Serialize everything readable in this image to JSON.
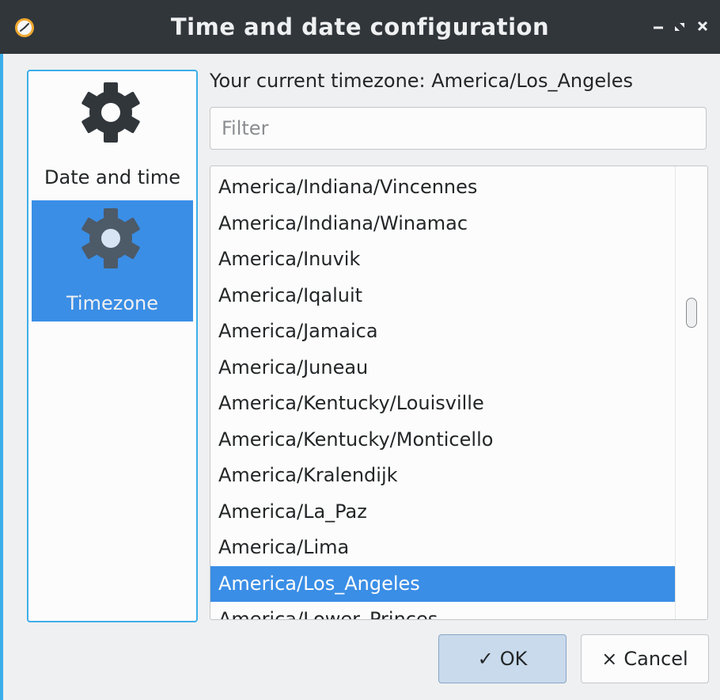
{
  "window": {
    "title": "Time and date configuration",
    "controls": [
      "minimize",
      "maximize",
      "close"
    ]
  },
  "sidebar": {
    "items": [
      {
        "label": "Date and time",
        "icon": "gear-icon",
        "selected": false
      },
      {
        "label": "Timezone",
        "icon": "gear-icon",
        "selected": true
      }
    ]
  },
  "timezone": {
    "current_label": "Your current timezone:  America/Los_Angeles"
  },
  "filter": {
    "placeholder": "Filter",
    "value": ""
  },
  "timezone_list": {
    "items": [
      "America/Indiana/Vincennes",
      "America/Indiana/Winamac",
      "America/Inuvik",
      "America/Iqaluit",
      "America/Jamaica",
      "America/Juneau",
      "America/Kentucky/Louisville",
      "America/Kentucky/Monticello",
      "America/Kralendijk",
      "America/La_Paz",
      "America/Lima",
      "America/Los_Angeles",
      "America/Lower_Princes"
    ],
    "selected": "America/Los_Angeles"
  },
  "buttons": {
    "ok": {
      "icon": "✓",
      "label": "OK"
    },
    "cancel": {
      "icon": "×",
      "label": "Cancel"
    }
  },
  "colors": {
    "titlebar": "#31363b",
    "accent": "#3daee9",
    "selection": "#3a8ee6",
    "icon_fill": "#4d5a68"
  }
}
